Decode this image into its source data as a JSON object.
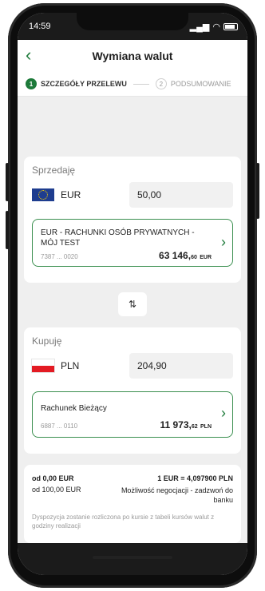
{
  "status": {
    "time": "14:59"
  },
  "nav": {
    "title": "Wymiana walut"
  },
  "steps": [
    {
      "num": "1",
      "label": "SZCZEGÓŁY PRZELEWU"
    },
    {
      "num": "2",
      "label": "PODSUMOWANIE"
    }
  ],
  "sell": {
    "label": "Sprzedaję",
    "currency": "EUR",
    "amount": "50,00",
    "account": {
      "name": "EUR - RACHUNKI OSÓB PRYWATNYCH - MÓJ TEST",
      "number": "7387 ... 0020",
      "balance_main": "63 146,",
      "balance_decimals": "60",
      "balance_currency": "EUR"
    }
  },
  "buy": {
    "label": "Kupuję",
    "currency": "PLN",
    "amount": "204,90",
    "account": {
      "name": "Rachunek Bieżący",
      "number": "6887 ... 0110",
      "balance_main": "11 973,",
      "balance_decimals": "62",
      "balance_currency": "PLN"
    }
  },
  "rates": {
    "tier1_from": "od 0,00 EUR",
    "tier1_rate": "1 EUR = 4,097900 PLN",
    "tier2_from": "od 100,00 EUR",
    "tier2_rate": "Możliwość negocjacji - zadzwoń do banku"
  },
  "note": "Dyspozycja zostanie rozliczona po kursie z tabeli kursów walut z godziny realizacji",
  "icons": {
    "back": "chevron-left-icon",
    "swap": "swap-vertical-icon",
    "account_chevron": "chevron-right-icon"
  },
  "colors": {
    "accent": "#1d7a3a"
  }
}
